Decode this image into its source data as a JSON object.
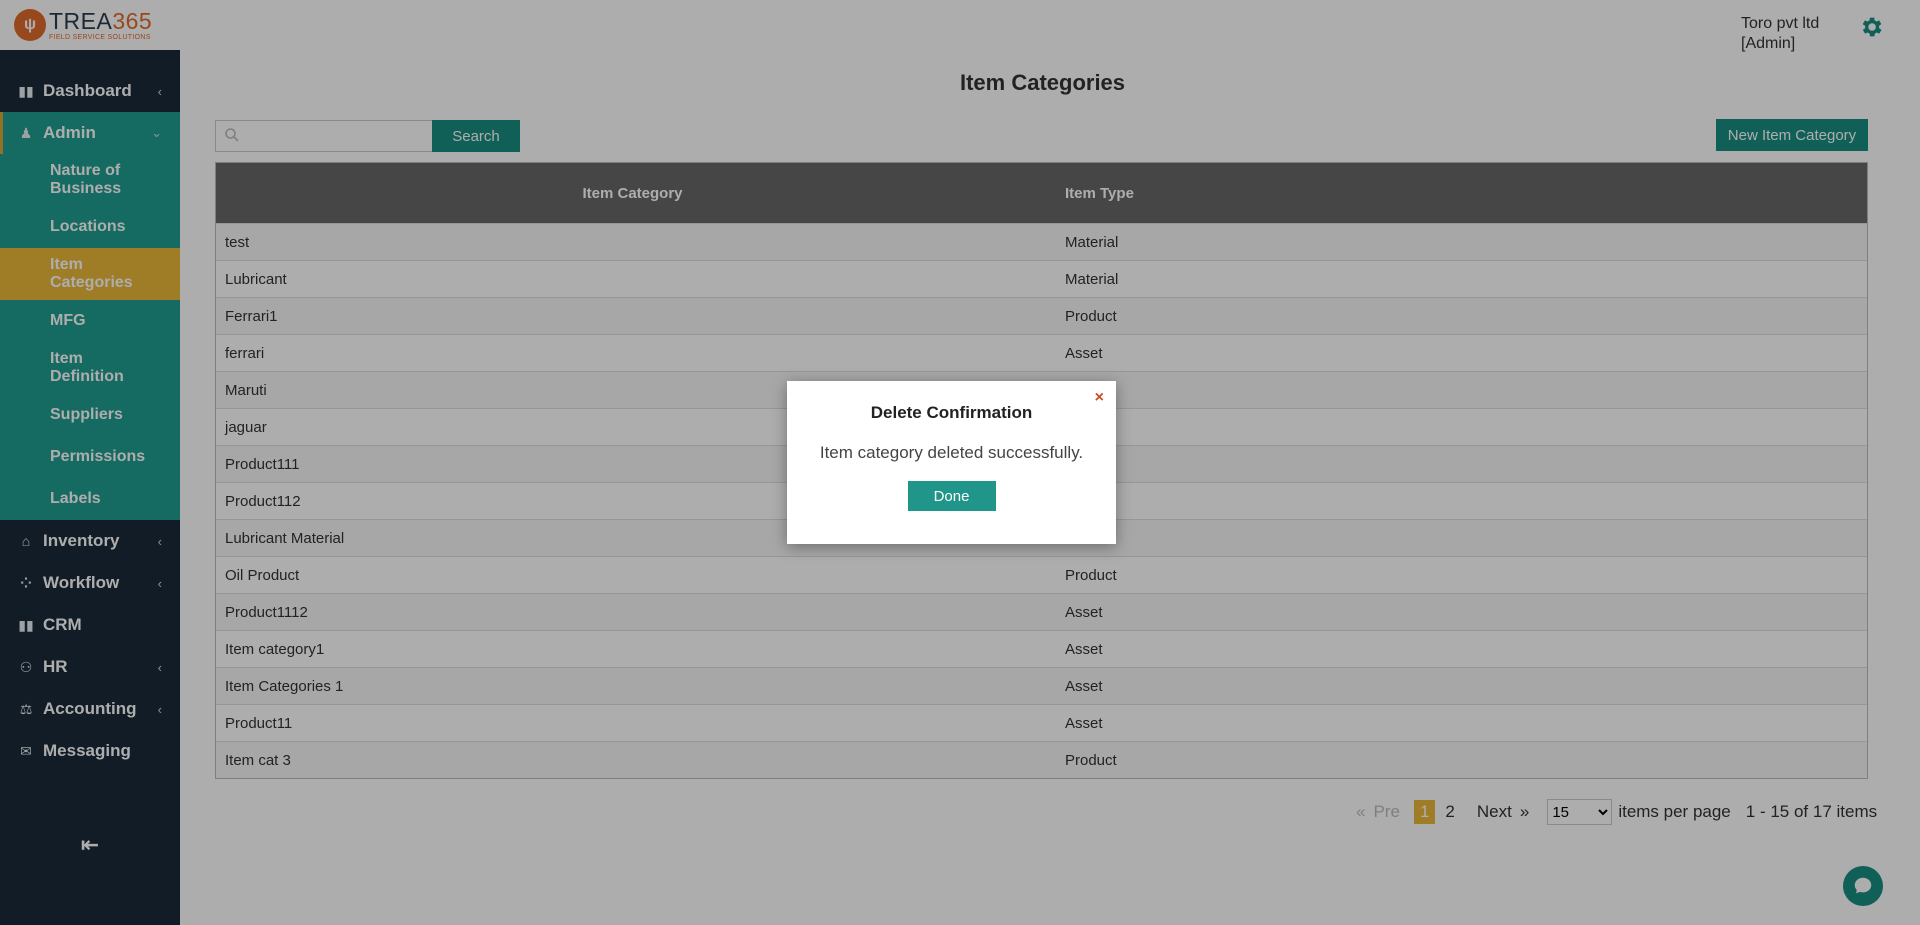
{
  "logo": {
    "brand": "TREA",
    "brand_num": "365",
    "tagline": "FIELD SERVICE SOLUTIONS"
  },
  "header": {
    "user_company": "Toro pvt ltd",
    "user_role": "[Admin]"
  },
  "sidebar": {
    "items": [
      {
        "label": "Dashboard",
        "icon": "bar-chart-icon"
      },
      {
        "label": "Admin",
        "icon": "user-icon"
      },
      {
        "label": "Inventory",
        "icon": "home-icon"
      },
      {
        "label": "Workflow",
        "icon": "workflow-icon"
      },
      {
        "label": "CRM",
        "icon": "bar-chart-icon"
      },
      {
        "label": "HR",
        "icon": "people-icon"
      },
      {
        "label": "Accounting",
        "icon": "scale-icon"
      },
      {
        "label": "Messaging",
        "icon": "chat-icon"
      }
    ],
    "admin_submenu": [
      "Nature of Business",
      "Locations",
      "Item Categories",
      "MFG",
      "Item Definition",
      "Suppliers",
      "Permissions",
      "Labels"
    ],
    "selected_submenu": "Item Categories"
  },
  "page": {
    "title": "Item Categories",
    "search_button": "Search",
    "search_placeholder": "",
    "new_button": "New Item Category"
  },
  "table": {
    "headers": [
      "Item Category",
      "Item Type"
    ],
    "rows": [
      [
        "test",
        "Material"
      ],
      [
        "Lubricant",
        "Material"
      ],
      [
        "Ferrari1",
        "Product"
      ],
      [
        "ferrari",
        "Asset"
      ],
      [
        "Maruti",
        ""
      ],
      [
        "jaguar",
        ""
      ],
      [
        "Product111",
        ""
      ],
      [
        "Product112",
        ""
      ],
      [
        "Lubricant Material",
        ""
      ],
      [
        "Oil Product",
        "Product"
      ],
      [
        "Product1112",
        "Asset"
      ],
      [
        "Item category1",
        "Asset"
      ],
      [
        "Item Categories 1",
        "Asset"
      ],
      [
        "Product11",
        "Asset"
      ],
      [
        "Item cat 3",
        "Product"
      ]
    ]
  },
  "pagination": {
    "prev": "Pre",
    "pages": [
      "1",
      "2"
    ],
    "current_page": "1",
    "next": "Next",
    "per_page": "15",
    "per_page_label": "items per page",
    "summary": "1 - 15 of 17 items"
  },
  "modal": {
    "title": "Delete Confirmation",
    "message": "Item category deleted successfully.",
    "button": "Done",
    "close_glyph": "×"
  },
  "colors": {
    "sidebar_bg": "#1b2a38",
    "teal": "#1f9c90",
    "selected": "#e9b838",
    "brand_orange": "#e06a2c"
  }
}
